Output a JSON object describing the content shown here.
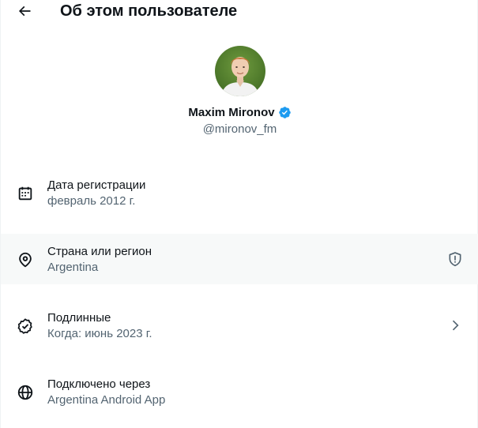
{
  "header": {
    "title": "Об этом пользователе",
    "back_icon": "arrow-left-icon"
  },
  "profile": {
    "display_name": "Maxim Mironov",
    "handle": "@mironov_fm",
    "verified": true,
    "verified_color": "#1d9bf0"
  },
  "rows": [
    {
      "icon": "calendar-icon",
      "label": "Дата регистрации",
      "value": "февраль 2012 г."
    },
    {
      "icon": "location-pin-icon",
      "label": "Страна или регион",
      "value": "Argentina",
      "trailing_icon": "shield-alert-icon"
    },
    {
      "icon": "verified-check-icon",
      "label": "Подлинные",
      "value": "Когда: июнь 2023 г.",
      "trailing_icon": "chevron-right-icon"
    },
    {
      "icon": "globe-icon",
      "label": "Подключено через",
      "value": "Argentina Android App"
    }
  ],
  "colors": {
    "text_primary": "#0f1419",
    "text_secondary": "#536471",
    "hover_bg": "#f7f9f9"
  }
}
